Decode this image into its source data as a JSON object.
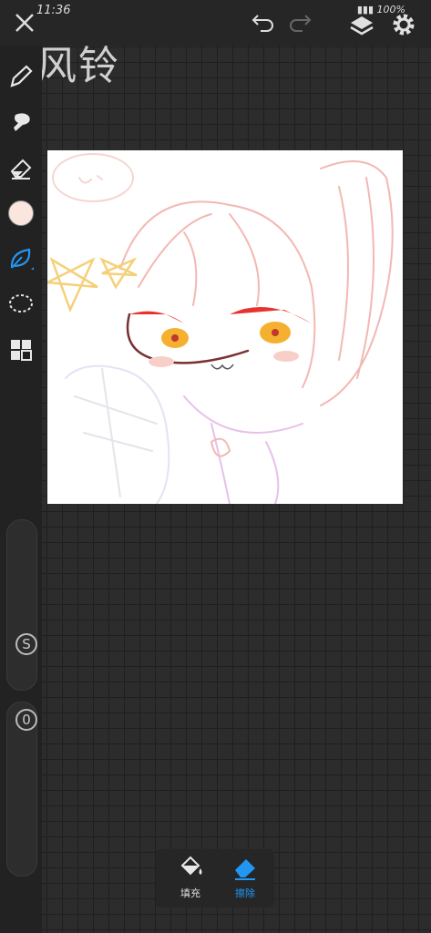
{
  "status": {
    "time": "11:36",
    "battery": "100%"
  },
  "watermark": "风铃",
  "bottom_panel": {
    "fill_label": "填充",
    "erase_label": "擦除"
  },
  "sliders": {
    "size_label": "S",
    "opacity_label": "0"
  },
  "colors": {
    "accent": "#2196f3",
    "current_color": "#fbe5df"
  }
}
